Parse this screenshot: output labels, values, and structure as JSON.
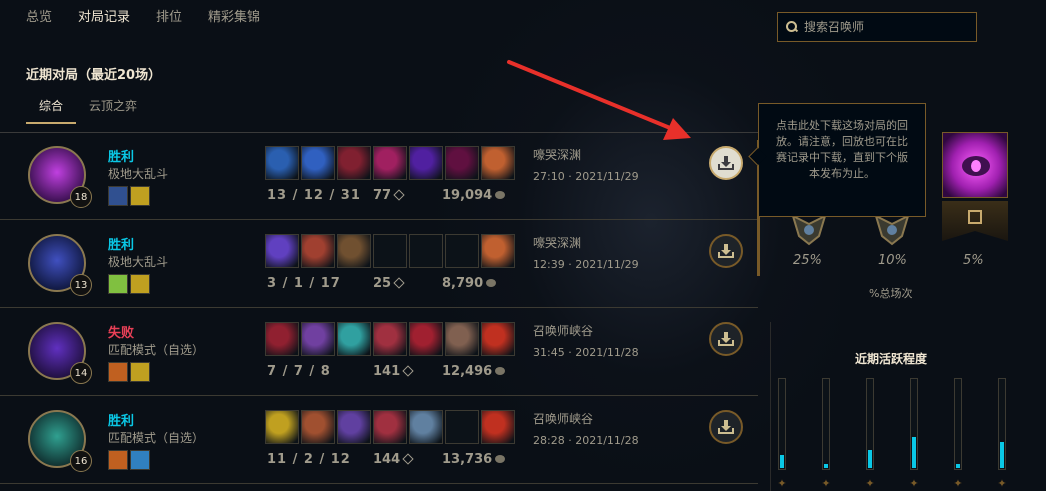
{
  "nav": {
    "tabs": [
      "总览",
      "对局记录",
      "排位",
      "精彩集锦"
    ],
    "active_index": 1
  },
  "search": {
    "placeholder": "搜索召唤师"
  },
  "section": {
    "title": "近期对局（最近20场）"
  },
  "subtabs": {
    "items": [
      "综合",
      "云顶之弈"
    ],
    "active_index": 0
  },
  "tooltip": {
    "text": "点击此处下载这场对局的回放。请注意，回放也可在比赛记录中下载，直到下个版本发布为止。"
  },
  "matches": [
    {
      "result": "胜利",
      "result_type": "win",
      "mode": "极地大乱斗",
      "level": "18",
      "kda": "13 / 12 / 31",
      "cs": "77",
      "gold": "19,094",
      "map": "嚎哭深渊",
      "duration": "27:10",
      "date": "2021/11/29",
      "champ_colors": [
        "#c040e0",
        "#3a1050"
      ],
      "item_colors": [
        "#2a5fb0",
        "#3060c0",
        "#802030",
        "#a02060",
        "#5020a0",
        "#601040",
        "#c06030"
      ],
      "item_filled": [
        true,
        true,
        true,
        true,
        true,
        true,
        true
      ],
      "spell_colors": [
        "#305090",
        "#c0a020"
      ]
    },
    {
      "result": "胜利",
      "result_type": "win",
      "mode": "极地大乱斗",
      "level": "13",
      "kda": "3 / 1 / 17",
      "cs": "25",
      "gold": "8,790",
      "map": "嚎哭深渊",
      "duration": "12:39",
      "date": "2021/11/29",
      "champ_colors": [
        "#4050c0",
        "#101840"
      ],
      "item_colors": [
        "#6040c0",
        "#a04030",
        "#705030",
        "#0c1218",
        "#0c1218",
        "#0c1218",
        "#c06030"
      ],
      "item_filled": [
        true,
        true,
        true,
        false,
        false,
        false,
        true
      ],
      "spell_colors": [
        "#80c040",
        "#c0a020"
      ]
    },
    {
      "result": "失败",
      "result_type": "lose",
      "mode": "匹配模式（自选）",
      "level": "14",
      "kda": "7 / 7 / 8",
      "cs": "141",
      "gold": "12,496",
      "map": "召唤师峡谷",
      "duration": "31:45",
      "date": "2021/11/28",
      "champ_colors": [
        "#6030c0",
        "#201040"
      ],
      "item_colors": [
        "#902030",
        "#7040a0",
        "#30a0a0",
        "#a03040",
        "#a02030",
        "#806050",
        "#c03020"
      ],
      "item_filled": [
        true,
        true,
        true,
        true,
        true,
        true,
        true
      ],
      "spell_colors": [
        "#c06020",
        "#c0a020"
      ]
    },
    {
      "result": "胜利",
      "result_type": "win",
      "mode": "匹配模式（自选）",
      "level": "16",
      "kda": "11 / 2 / 12",
      "cs": "144",
      "gold": "13,736",
      "map": "召唤师峡谷",
      "duration": "28:28",
      "date": "2021/11/28",
      "champ_colors": [
        "#30a090",
        "#103030"
      ],
      "item_colors": [
        "#c0a020",
        "#a05030",
        "#6040a0",
        "#a03040",
        "#6080a0",
        "#0c1218",
        "#c03020"
      ],
      "item_filled": [
        true,
        true,
        true,
        true,
        true,
        false,
        true
      ],
      "spell_colors": [
        "#c06020",
        "#3080c0"
      ]
    }
  ],
  "right_panel": {
    "percents": [
      "25%",
      "10%",
      "5%"
    ],
    "percent_label": "%总场次",
    "activity_title": "近期活跃程度",
    "activity_levels": [
      0.15,
      0.05,
      0.2,
      0.35,
      0.05,
      0.3
    ],
    "role_icons": [
      "top-role-icon",
      "jungle-role-icon",
      "mid-role-icon",
      "bot-role-icon",
      "support-role-icon",
      "fill-role-icon"
    ]
  },
  "colors": {
    "gold": "#c8aa6e",
    "win": "#0ac8e6",
    "lose": "#e84057",
    "arrow": "#e8302a"
  }
}
